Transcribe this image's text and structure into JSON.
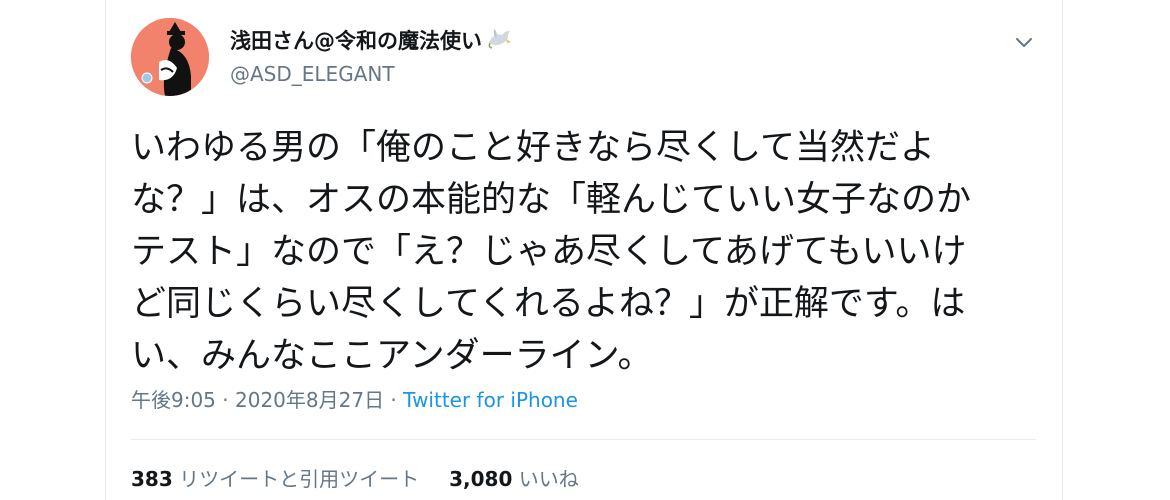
{
  "user": {
    "display_name": "浅田さん@令和の魔法使い",
    "handle": "@ASD_ELEGANT",
    "avatar_bg": "#f2826b"
  },
  "tweet": {
    "lines": [
      "いわゆる男の「俺のこと好きなら尽くして当然だよ",
      "な？」は、オスの本能的な「軽んじていい女子なのか",
      "テスト」なので「え？じゃあ尽くしてあげてもいいけ",
      "ど同じくらい尽くしてくれるよね？」が正解です。は",
      "い、みんなここアンダーライン。"
    ]
  },
  "meta": {
    "time": "午後9:05",
    "sep1": " · ",
    "date": "2020年8月27日",
    "sep2": " · ",
    "source": "Twitter for iPhone",
    "link_color": "#1b95e0"
  },
  "stats": {
    "retweets_count": "383",
    "retweets_label": "リツイートと引用ツイート",
    "likes_count": "3,080",
    "likes_label": "いいね"
  },
  "icons": {
    "menu": "chevron-down-icon",
    "name_emoji": "dove-icon"
  }
}
